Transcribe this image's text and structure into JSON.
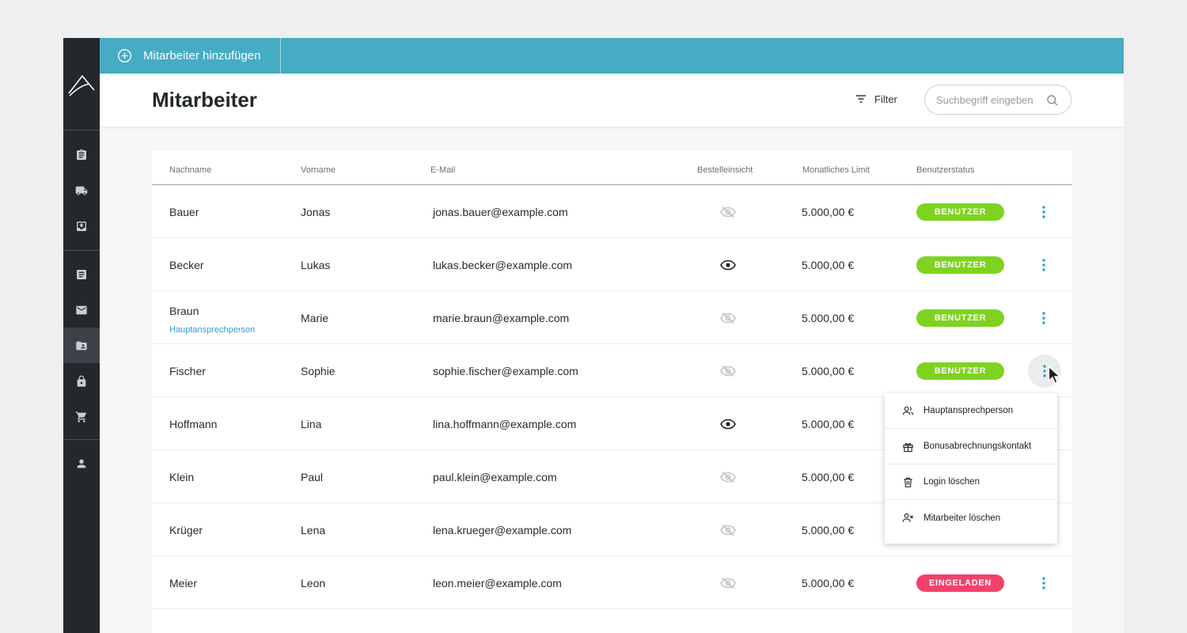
{
  "topbar": {
    "add_label": "Mitarbeiter hinzufügen"
  },
  "header": {
    "title": "Mitarbeiter",
    "filter_label": "Filter",
    "search_placeholder": "Suchbegriff eingeben",
    "search_value": ""
  },
  "table": {
    "columns": [
      "Nachname",
      "Vorname",
      "E-Mail",
      "Bestelleinsicht",
      "Monatliches Limit",
      "Benutzerstatus"
    ],
    "rows": [
      {
        "nachname": "Bauer",
        "vorname": "Jonas",
        "email": "jonas.bauer@example.com",
        "einsicht": false,
        "limit": "5.000,00 €",
        "status": "BENUTZER",
        "sub": ""
      },
      {
        "nachname": "Becker",
        "vorname": "Lukas",
        "email": "lukas.becker@example.com",
        "einsicht": true,
        "limit": "5.000,00 €",
        "status": "BENUTZER",
        "sub": ""
      },
      {
        "nachname": "Braun",
        "vorname": "Marie",
        "email": "marie.braun@example.com",
        "einsicht": false,
        "limit": "5.000,00 €",
        "status": "BENUTZER",
        "sub": "Hauptansprechperson"
      },
      {
        "nachname": "Fischer",
        "vorname": "Sophie",
        "email": "sophie.fischer@example.com",
        "einsicht": false,
        "limit": "5.000,00 €",
        "status": "BENUTZER",
        "sub": ""
      },
      {
        "nachname": "Hoffmann",
        "vorname": "Lina",
        "email": "lina.hoffmann@example.com",
        "einsicht": true,
        "limit": "5.000,00 €",
        "status": "",
        "sub": ""
      },
      {
        "nachname": "Klein",
        "vorname": "Paul",
        "email": "paul.klein@example.com",
        "einsicht": false,
        "limit": "5.000,00 €",
        "status": "",
        "sub": ""
      },
      {
        "nachname": "Krüger",
        "vorname": "Lena",
        "email": "lena.krueger@example.com",
        "einsicht": false,
        "limit": "5.000,00 €",
        "status": "",
        "sub": ""
      },
      {
        "nachname": "Meier",
        "vorname": "Leon",
        "email": "leon.meier@example.com",
        "einsicht": false,
        "limit": "5.000,00 €",
        "status": "EINGELADEN",
        "sub": ""
      }
    ]
  },
  "context_menu": {
    "items": [
      {
        "label": "Hauptansprechperson",
        "icon": "users-icon"
      },
      {
        "label": "Bonusabrechnungskontakt",
        "icon": "gift-icon"
      },
      {
        "label": "Login löschen",
        "icon": "trash-icon"
      },
      {
        "label": "Mitarbeiter löschen",
        "icon": "user-remove-icon"
      }
    ]
  },
  "sidebar": {
    "items": [
      {
        "icon": "clipboard-icon"
      },
      {
        "icon": "truck-icon"
      },
      {
        "icon": "inbox-download-icon"
      },
      {
        "icon": "document-icon"
      },
      {
        "icon": "mail-icon"
      },
      {
        "icon": "contacts-folder-icon",
        "active": true
      },
      {
        "icon": "lock-icon"
      },
      {
        "icon": "cart-icon"
      },
      {
        "icon": "user-icon"
      }
    ]
  },
  "colors": {
    "accent": "#45acc4",
    "sidebar": "#23282c",
    "status_user": "#7ed321",
    "status_invited": "#f2426a",
    "link": "#2b9fcf"
  }
}
